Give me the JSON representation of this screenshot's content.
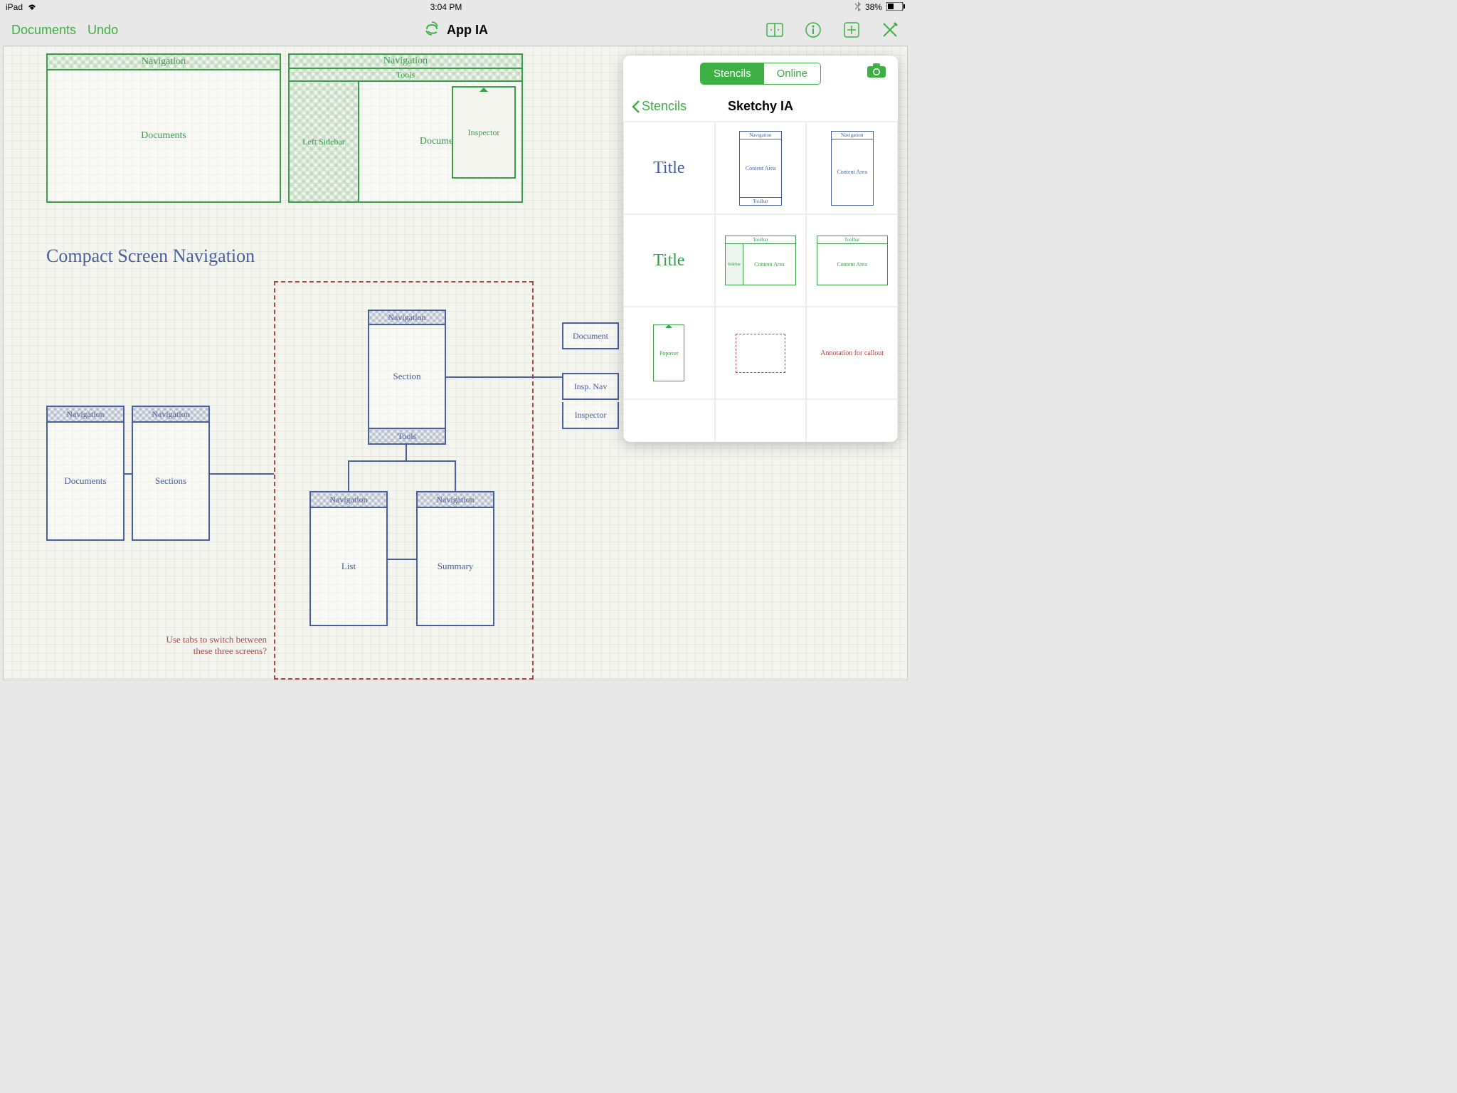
{
  "status": {
    "device": "iPad",
    "time": "3:04 PM",
    "battery": "38%"
  },
  "toolbar": {
    "documents": "Documents",
    "undo": "Undo",
    "title": "App IA"
  },
  "canvas": {
    "box1": {
      "nav": "Navigation",
      "content": "Documents"
    },
    "box2": {
      "nav": "Navigation",
      "tools": "Tools",
      "sidebar": "Left Sidebar",
      "document": "Document",
      "inspector": "Inspector"
    },
    "section_title": "Compact Screen Navigation",
    "box3": {
      "nav": "Navigation",
      "content": "Documents"
    },
    "box4": {
      "nav": "Navigation",
      "content": "Sections"
    },
    "box5": {
      "nav": "Navigation",
      "content": "Section",
      "tools": "Tools"
    },
    "box6": {
      "nav": "Navigation",
      "content": "List"
    },
    "box7": {
      "nav": "Navigation",
      "content": "Summary"
    },
    "box8": {
      "content": "Document"
    },
    "box9": {
      "content": "Insp. Nav"
    },
    "box10": {
      "content": "Inspector"
    },
    "annotation": "Use tabs to switch between these three screens?"
  },
  "popover": {
    "seg_stencils": "Stencils",
    "seg_online": "Online",
    "back": "Stencils",
    "title": "Sketchy IA",
    "cells": {
      "title_blue": "Title",
      "title_green": "Title",
      "nav": "Navigation",
      "content_area": "Content Area",
      "toolbar": "Toolbar",
      "sidebar": "Sidebar",
      "popover": "Popover",
      "annotation": "Annotation for callout"
    }
  }
}
